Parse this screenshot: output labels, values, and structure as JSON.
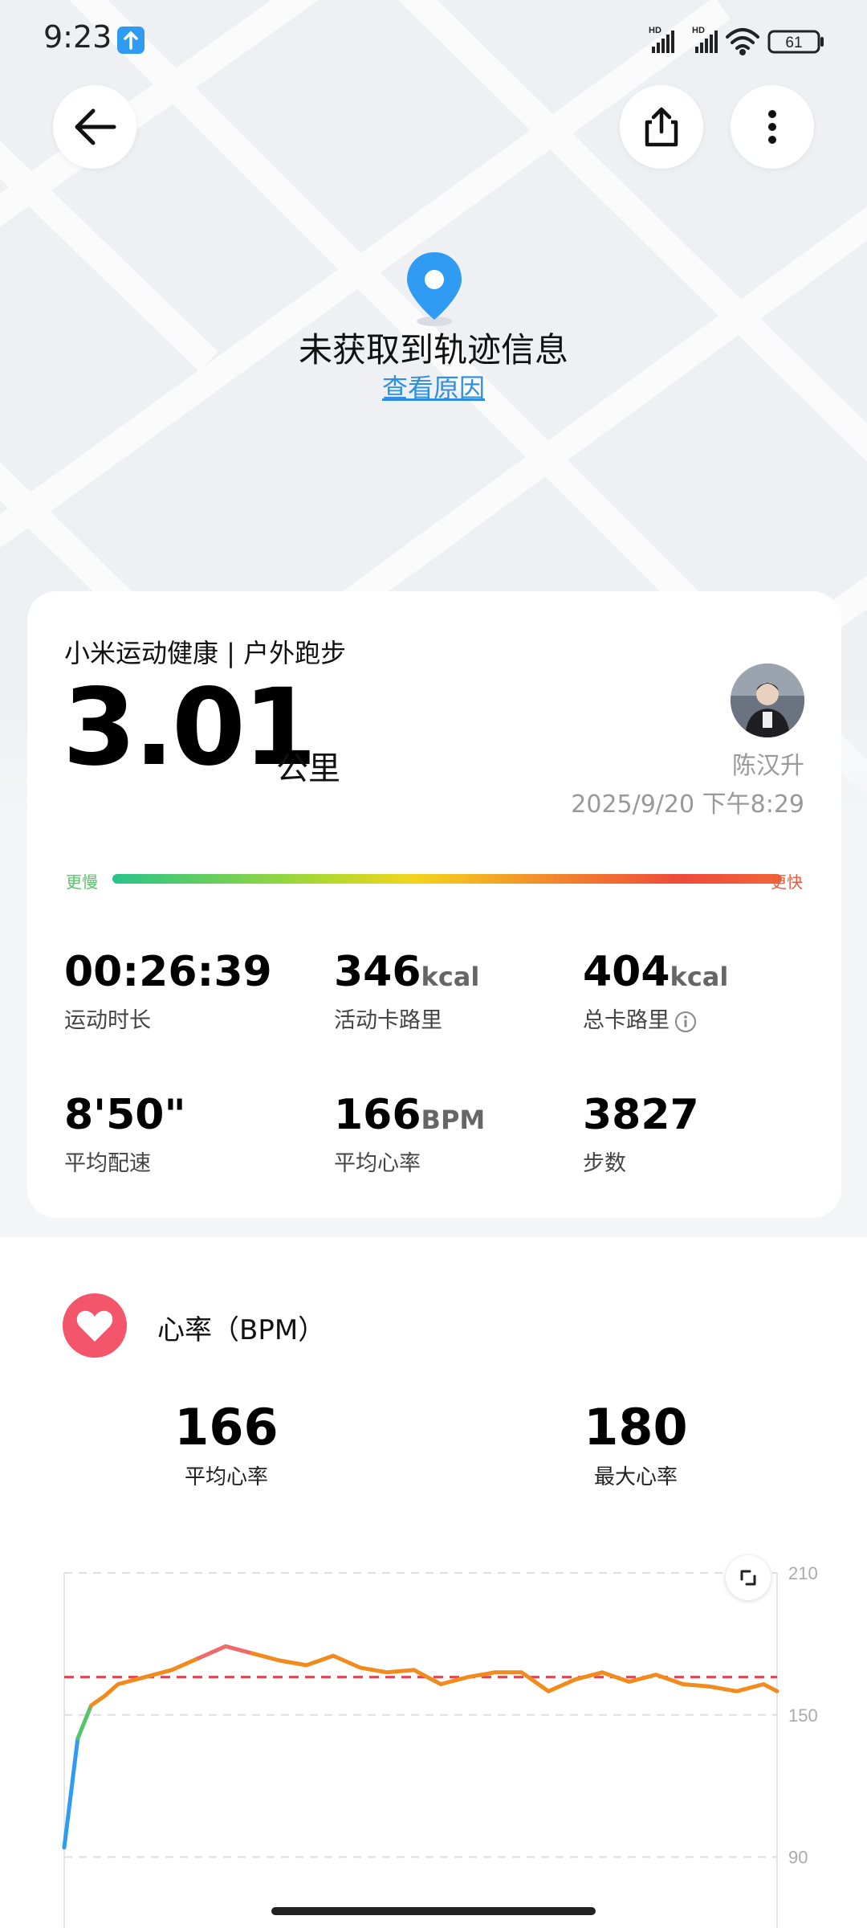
{
  "status_bar": {
    "time": "9:23",
    "signal_label_1": "HD",
    "signal_label_2": "HD",
    "battery": "61"
  },
  "map": {
    "no_track_text": "未获取到轨迹信息",
    "reason_link": "查看原因"
  },
  "summary": {
    "title": "小米运动健康 | 户外跑步",
    "distance": "3.01",
    "distance_unit": "公里",
    "username": "陈汉升",
    "datetime": "2025/9/20 下午8:29",
    "pace_slow_label": "更慢",
    "pace_fast_label": "更快",
    "stats": [
      {
        "value": "00:26:39",
        "unit": "",
        "label": "运动时长"
      },
      {
        "value": "346",
        "unit": "kcal",
        "label": "活动卡路里"
      },
      {
        "value": "404",
        "unit": "kcal",
        "label": "总卡路里"
      },
      {
        "value": "8'50\"",
        "unit": "",
        "label": "平均配速"
      },
      {
        "value": "166",
        "unit": "BPM",
        "label": "平均心率"
      },
      {
        "value": "3827",
        "unit": "",
        "label": "步数"
      }
    ]
  },
  "heart_rate": {
    "title": "心率（BPM）",
    "avg_value": "166",
    "avg_label": "平均心率",
    "max_value": "180",
    "max_label": "最大心率"
  },
  "chart_data": {
    "type": "line",
    "y_ticks": [
      "210",
      "150",
      "90"
    ],
    "ylim": [
      60,
      210
    ],
    "reference_line": 166,
    "reference_color": "#e8414f",
    "line_color": "#f28b1e",
    "start_color": "#2f9bf3",
    "mid_color": "#57c46a",
    "peak_color": "#ef6b6b",
    "x": [
      0,
      0.5,
      1,
      1.5,
      2,
      3,
      4,
      5,
      6,
      7,
      8,
      9,
      10,
      11,
      12,
      13,
      14,
      15,
      16,
      17,
      18,
      19,
      20,
      21,
      22,
      23,
      24,
      25,
      26,
      26.5
    ],
    "values": [
      94,
      140,
      154,
      158,
      163,
      166,
      169,
      174,
      179,
      176,
      173,
      171,
      175,
      170,
      168,
      169,
      163,
      166,
      168,
      168,
      160,
      165,
      168,
      164,
      167,
      163,
      162,
      160,
      163,
      160
    ]
  },
  "icons": {
    "back": "arrow-left-icon",
    "share": "share-icon",
    "more": "more-vertical-icon",
    "pin": "location-pin-icon",
    "heart": "heart-icon",
    "expand": "expand-icon",
    "info": "info-icon"
  }
}
